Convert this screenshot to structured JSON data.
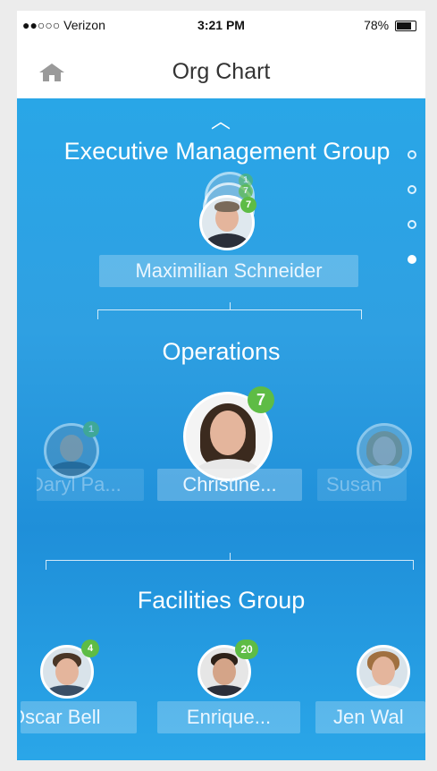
{
  "status": {
    "carrier": "●●○○○ Verizon",
    "time": "3:21 PM",
    "battery": "78%"
  },
  "nav": {
    "title": "Org Chart"
  },
  "sections": {
    "executive": {
      "title": "Executive Management Group",
      "stack_badges": [
        "1",
        "7",
        "7"
      ],
      "person": {
        "name": "Maximilian Schneider"
      }
    },
    "operations": {
      "title": "Operations",
      "left": {
        "name": "Daryl Pa...",
        "badge": "1"
      },
      "center": {
        "name": "Christine...",
        "badge": "7"
      },
      "right": {
        "name": "Susan"
      }
    },
    "facilities": {
      "title": "Facilities Group",
      "left": {
        "name": "Oscar Bell",
        "badge": "4"
      },
      "center": {
        "name": "Enrique...",
        "badge": "20"
      },
      "right": {
        "name": "Jen Wal"
      }
    }
  },
  "pager": {
    "count": 4,
    "active_index": 3
  },
  "colors": {
    "background": "#29a6e7",
    "badge": "#5ebc45",
    "name_chip": "#ffffff3d"
  }
}
